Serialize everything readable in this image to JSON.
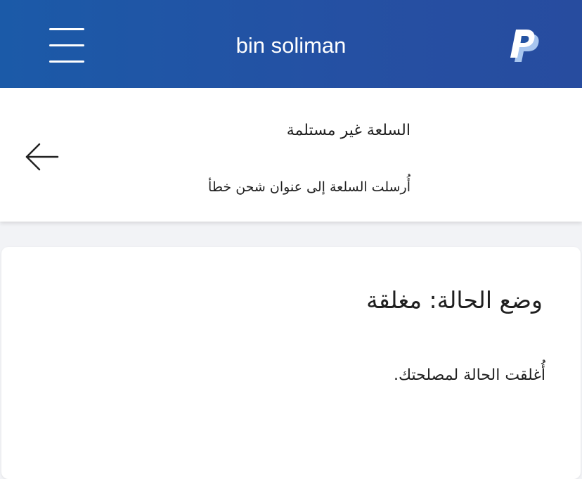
{
  "header": {
    "title": "bin soliman",
    "menu_icon": "menu-icon",
    "logo_icon": "paypal-logo-icon",
    "colors": {
      "bar_start": "#1b5aa8",
      "bar_end": "#274c9f"
    }
  },
  "case": {
    "reason": "السلعة غير مستلمة",
    "detail": "أُرسلت السلعة إلى عنوان شحن خطأ",
    "back_icon": "arrow-left-icon"
  },
  "status": {
    "title": "وضع الحالة: مغلقة",
    "message": "أُغلقت الحالة لمصلحتك."
  }
}
